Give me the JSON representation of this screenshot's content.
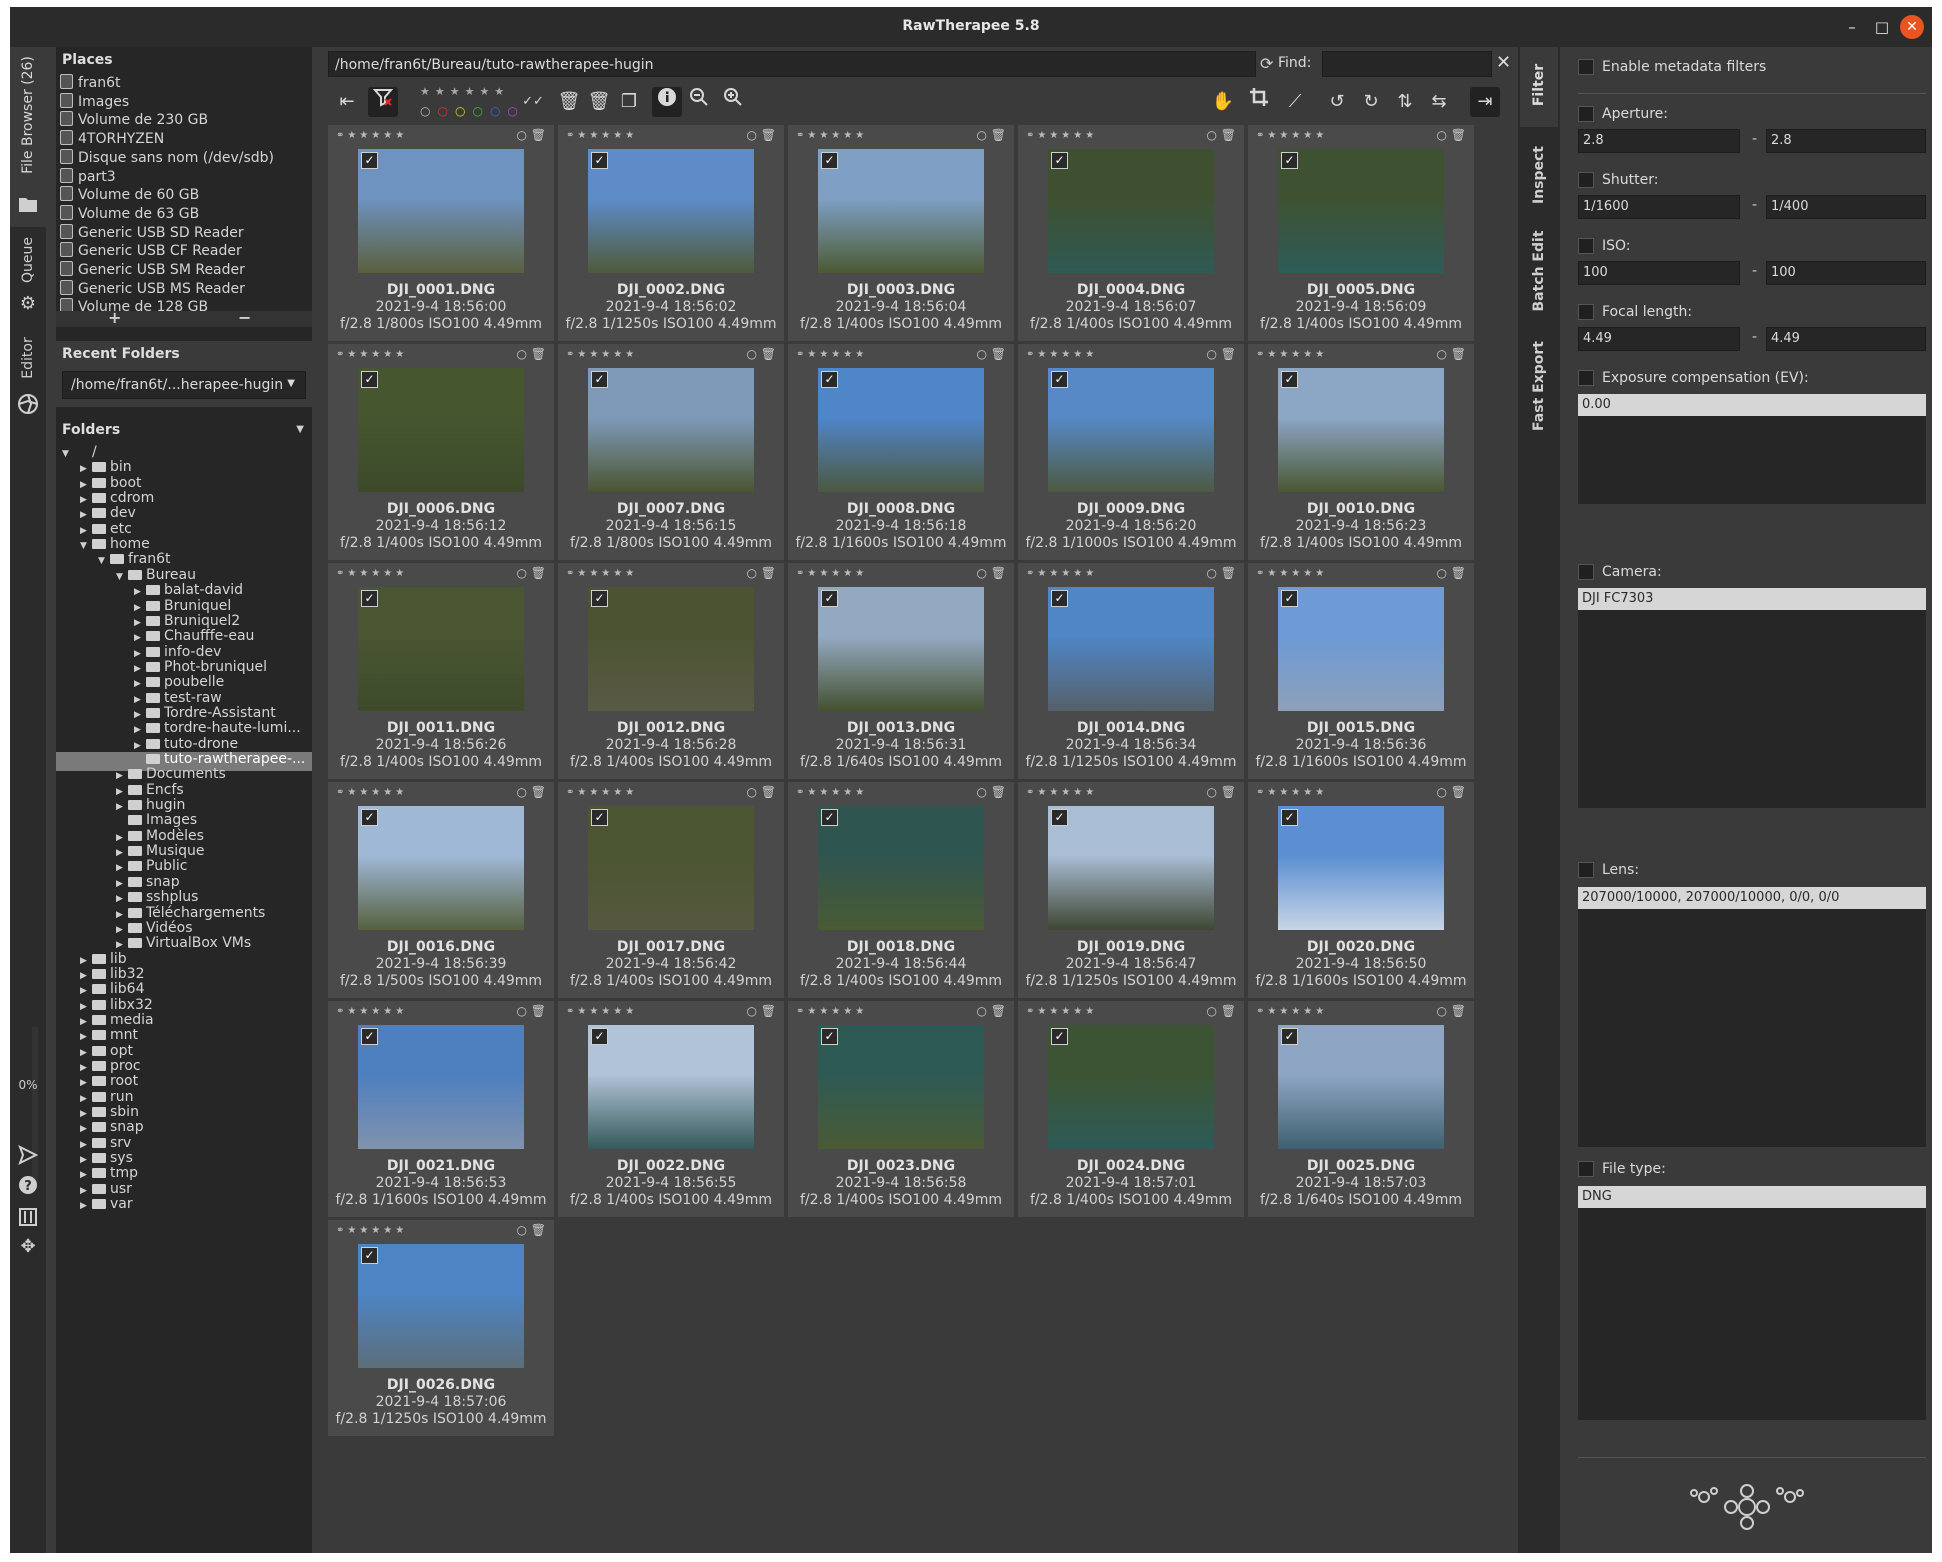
{
  "window": {
    "title": "RawTherapee 5.8",
    "minimize": "–",
    "maximize": "□",
    "close": "✕"
  },
  "left_tabs": {
    "file_browser": "File Browser (26)",
    "queue": "Queue",
    "editor": "Editor",
    "progress": "0%"
  },
  "places": {
    "header": "Places",
    "items": [
      "fran6t",
      "Images",
      "Volume de 230 GB",
      "4TORHYZEN",
      "Disque sans nom (/dev/sdb)",
      "part3",
      "Volume de 60 GB",
      "Volume de 63 GB",
      "Generic USB SD Reader",
      "Generic USB CF Reader",
      "Generic USB SM Reader",
      "Generic USB MS Reader",
      "Volume de 128 GB"
    ],
    "add": "+",
    "remove": "−"
  },
  "recent": {
    "header": "Recent Folders",
    "value": "/home/fran6t/...herapee-hugin"
  },
  "folders": {
    "header": "Folders",
    "tree": [
      {
        "label": "/",
        "depth": 0,
        "open": true,
        "icon": false
      },
      {
        "label": "bin",
        "depth": 1
      },
      {
        "label": "boot",
        "depth": 1
      },
      {
        "label": "cdrom",
        "depth": 1
      },
      {
        "label": "dev",
        "depth": 1
      },
      {
        "label": "etc",
        "depth": 1
      },
      {
        "label": "home",
        "depth": 1,
        "open": true
      },
      {
        "label": "fran6t",
        "depth": 2,
        "open": true
      },
      {
        "label": "Bureau",
        "depth": 3,
        "open": true
      },
      {
        "label": "balat-david",
        "depth": 4
      },
      {
        "label": "Bruniquel",
        "depth": 4
      },
      {
        "label": "Bruniquel2",
        "depth": 4
      },
      {
        "label": "Chaufffe-eau",
        "depth": 4
      },
      {
        "label": "info-dev",
        "depth": 4
      },
      {
        "label": "Phot-bruniquel",
        "depth": 4
      },
      {
        "label": "poubelle",
        "depth": 4
      },
      {
        "label": "test-raw",
        "depth": 4
      },
      {
        "label": "Tordre-Assistant",
        "depth": 4
      },
      {
        "label": "tordre-haute-lumi...",
        "depth": 4
      },
      {
        "label": "tuto-drone",
        "depth": 4
      },
      {
        "label": "tuto-rawtherapee-...",
        "depth": 4,
        "selected": true,
        "noarrow": true
      },
      {
        "label": "Documents",
        "depth": 3
      },
      {
        "label": "Encfs",
        "depth": 3
      },
      {
        "label": "hugin",
        "depth": 3
      },
      {
        "label": "Images",
        "depth": 3,
        "noarrow": true
      },
      {
        "label": "Modèles",
        "depth": 3
      },
      {
        "label": "Musique",
        "depth": 3
      },
      {
        "label": "Public",
        "depth": 3
      },
      {
        "label": "snap",
        "depth": 3
      },
      {
        "label": "sshplus",
        "depth": 3
      },
      {
        "label": "Téléchargements",
        "depth": 3
      },
      {
        "label": "Vidéos",
        "depth": 3
      },
      {
        "label": "VirtualBox VMs",
        "depth": 3
      },
      {
        "label": "lib",
        "depth": 1
      },
      {
        "label": "lib32",
        "depth": 1
      },
      {
        "label": "lib64",
        "depth": 1
      },
      {
        "label": "libx32",
        "depth": 1
      },
      {
        "label": "media",
        "depth": 1
      },
      {
        "label": "mnt",
        "depth": 1
      },
      {
        "label": "opt",
        "depth": 1
      },
      {
        "label": "proc",
        "depth": 1
      },
      {
        "label": "root",
        "depth": 1
      },
      {
        "label": "run",
        "depth": 1
      },
      {
        "label": "sbin",
        "depth": 1
      },
      {
        "label": "snap",
        "depth": 1
      },
      {
        "label": "srv",
        "depth": 1
      },
      {
        "label": "sys",
        "depth": 1
      },
      {
        "label": "tmp",
        "depth": 1
      },
      {
        "label": "usr",
        "depth": 1
      },
      {
        "label": "var",
        "depth": 1
      }
    ]
  },
  "pathbar": {
    "path": "/home/fran6t/Bureau/tuto-rawtherapee-hugin",
    "find_label": "Find:",
    "find_value": ""
  },
  "thumbnails": [
    {
      "name": "DJI_0001.DNG",
      "date": "2021-9-4 18:56:00",
      "exif": "f/2.8 1/800s ISO100 4.49mm",
      "sky": "#6f93c0",
      "ground": "#5a5f3d"
    },
    {
      "name": "DJI_0002.DNG",
      "date": "2021-9-4 18:56:02",
      "exif": "f/2.8 1/1250s ISO100 4.49mm",
      "sky": "#5d8cc8",
      "ground": "#4f5a3a"
    },
    {
      "name": "DJI_0003.DNG",
      "date": "2021-9-4 18:56:04",
      "exif": "f/2.8 1/400s ISO100 4.49mm",
      "sky": "#7f9fc4",
      "ground": "#4b5a33"
    },
    {
      "name": "DJI_0004.DNG",
      "date": "2021-9-4 18:56:07",
      "exif": "f/2.8 1/400s ISO100 4.49mm",
      "sky": "#3f5030",
      "ground": "#2f5a55"
    },
    {
      "name": "DJI_0005.DNG",
      "date": "2021-9-4 18:56:09",
      "exif": "f/2.8 1/400s ISO100 4.49mm",
      "sky": "#3e5232",
      "ground": "#2e5c58"
    },
    {
      "name": "DJI_0006.DNG",
      "date": "2021-9-4 18:56:12",
      "exif": "f/2.8 1/400s ISO100 4.49mm",
      "sky": "#46562f",
      "ground": "#3c4a2a"
    },
    {
      "name": "DJI_0007.DNG",
      "date": "2021-9-4 18:56:15",
      "exif": "f/2.8 1/800s ISO100 4.49mm",
      "sky": "#7f9ab8",
      "ground": "#4a5532"
    },
    {
      "name": "DJI_0008.DNG",
      "date": "2021-9-4 18:56:18",
      "exif": "f/2.8 1/1600s ISO100 4.49mm",
      "sky": "#4f86c8",
      "ground": "#4c5840"
    },
    {
      "name": "DJI_0009.DNG",
      "date": "2021-9-4 18:56:20",
      "exif": "f/2.8 1/1000s ISO100 4.49mm",
      "sky": "#5689c6",
      "ground": "#4d5941"
    },
    {
      "name": "DJI_0010.DNG",
      "date": "2021-9-4 18:56:23",
      "exif": "f/2.8 1/400s ISO100 4.49mm",
      "sky": "#8ca6c6",
      "ground": "#4a5732"
    },
    {
      "name": "DJI_0011.DNG",
      "date": "2021-9-4 18:56:26",
      "exif": "f/2.8 1/400s ISO100 4.49mm",
      "sky": "#4a5632",
      "ground": "#3d4a2b"
    },
    {
      "name": "DJI_0012.DNG",
      "date": "2021-9-4 18:56:28",
      "exif": "f/2.8 1/400s ISO100 4.49mm",
      "sky": "#4c5333",
      "ground": "#5a5a44"
    },
    {
      "name": "DJI_0013.DNG",
      "date": "2021-9-4 18:56:31",
      "exif": "f/2.8 1/640s ISO100 4.49mm",
      "sky": "#93a9c2",
      "ground": "#44512f"
    },
    {
      "name": "DJI_0014.DNG",
      "date": "2021-9-4 18:56:34",
      "exif": "f/2.8 1/1250s ISO100 4.49mm",
      "sky": "#4f86c6",
      "ground": "#55606a"
    },
    {
      "name": "DJI_0015.DNG",
      "date": "2021-9-4 18:56:36",
      "exif": "f/2.8 1/1600s ISO100 4.49mm",
      "sky": "#6c9bd6",
      "ground": "#8ea0b8"
    },
    {
      "name": "DJI_0016.DNG",
      "date": "2021-9-4 18:56:39",
      "exif": "f/2.8 1/500s ISO100 4.49mm",
      "sky": "#9fb8d6",
      "ground": "#56603f"
    },
    {
      "name": "DJI_0017.DNG",
      "date": "2021-9-4 18:56:42",
      "exif": "f/2.8 1/400s ISO100 4.49mm",
      "sky": "#4b5532",
      "ground": "#57583f"
    },
    {
      "name": "DJI_0018.DNG",
      "date": "2021-9-4 18:56:44",
      "exif": "f/2.8 1/400s ISO100 4.49mm",
      "sky": "#2f5550",
      "ground": "#4a5a33"
    },
    {
      "name": "DJI_0019.DNG",
      "date": "2021-9-4 18:56:47",
      "exif": "f/2.8 1/1250s ISO100 4.49mm",
      "sky": "#a9bdd4",
      "ground": "#3e4633"
    },
    {
      "name": "DJI_0020.DNG",
      "date": "2021-9-4 18:56:50",
      "exif": "f/2.8 1/1600s ISO100 4.49mm",
      "sky": "#5b8fd2",
      "ground": "#c7d5e6"
    },
    {
      "name": "DJI_0021.DNG",
      "date": "2021-9-4 18:56:53",
      "exif": "f/2.8 1/1600s ISO100 4.49mm",
      "sky": "#4e7fbf",
      "ground": "#8093ad"
    },
    {
      "name": "DJI_0022.DNG",
      "date": "2021-9-4 18:56:55",
      "exif": "f/2.8 1/400s ISO100 4.49mm",
      "sky": "#b0c3d8",
      "ground": "#355a5a"
    },
    {
      "name": "DJI_0023.DNG",
      "date": "2021-9-4 18:56:58",
      "exif": "f/2.8 1/400s ISO100 4.49mm",
      "sky": "#2e5a55",
      "ground": "#4a5a34"
    },
    {
      "name": "DJI_0024.DNG",
      "date": "2021-9-4 18:57:01",
      "exif": "f/2.8 1/400s ISO100 4.49mm",
      "sky": "#3d5434",
      "ground": "#2d5b58"
    },
    {
      "name": "DJI_0025.DNG",
      "date": "2021-9-4 18:57:03",
      "exif": "f/2.8 1/640s ISO100 4.49mm",
      "sky": "#8ea6c4",
      "ground": "#3f6070"
    },
    {
      "name": "DJI_0026.DNG",
      "date": "2021-9-4 18:57:06",
      "exif": "f/2.8 1/1250s ISO100 4.49mm",
      "sky": "#4d84c4",
      "ground": "#5c6e7a"
    }
  ],
  "right_tabs": {
    "filter": "Filter",
    "inspect": "Inspect",
    "batch_edit": "Batch Edit",
    "fast_export": "Fast Export"
  },
  "filter": {
    "enable_metadata": "Enable metadata filters",
    "aperture": {
      "label": "Aperture:",
      "from": "2.8",
      "to": "2.8"
    },
    "shutter": {
      "label": "Shutter:",
      "from": "1/1600",
      "to": "1/400"
    },
    "iso": {
      "label": "ISO:",
      "from": "100",
      "to": "100"
    },
    "focal": {
      "label": "Focal length:",
      "from": "4.49",
      "to": "4.49"
    },
    "range_sep": "-",
    "exposure": {
      "label": "Exposure compensation (EV):",
      "value": "0.00"
    },
    "camera": {
      "label": "Camera:",
      "value": "DJI FC7303"
    },
    "lens": {
      "label": "Lens:",
      "value": "207000/10000, 207000/10000, 0/0, 0/0"
    },
    "filetype": {
      "label": "File type:",
      "value": "DNG"
    }
  }
}
